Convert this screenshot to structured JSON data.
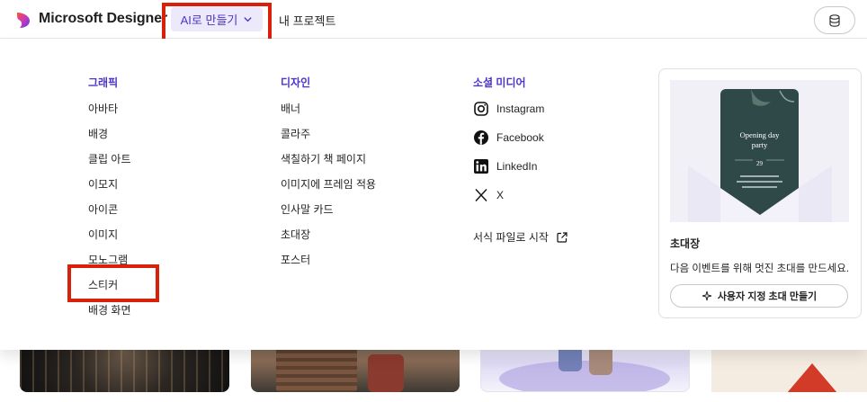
{
  "header": {
    "app_name": "Microsoft Designer",
    "ai_menu_label": "AI로 만들기",
    "projects_label": "내 프로젝트",
    "credits_icon": "coins-icon"
  },
  "menu": {
    "graphics": {
      "heading": "그래픽",
      "items": [
        "아바타",
        "배경",
        "클립 아트",
        "이모지",
        "아이콘",
        "이미지",
        "모노그램",
        "스티커",
        "배경 화면"
      ]
    },
    "design": {
      "heading": "디자인",
      "items": [
        "배너",
        "콜라주",
        "색칠하기 책 페이지",
        "이미지에 프레임 적용",
        "인사말 카드",
        "초대장",
        "포스터"
      ]
    },
    "social": {
      "heading": "소셜 미디어",
      "items": [
        {
          "label": "Instagram",
          "icon": "instagram-icon"
        },
        {
          "label": "Facebook",
          "icon": "facebook-icon"
        },
        {
          "label": "LinkedIn",
          "icon": "linkedin-icon"
        },
        {
          "label": "X",
          "icon": "x-icon"
        }
      ],
      "start_from_template": "서식 파일로 시작"
    }
  },
  "promo_card": {
    "image_text_line1": "Opening day",
    "image_text_line2": "party",
    "image_date_day": "29",
    "title": "초대장",
    "description": "다음 이벤트를 위해 멋진 초대를 만드세요.",
    "button_label": "사용자 지정 초대 만들기"
  },
  "colors": {
    "accent": "#4b36c9",
    "highlight_box": "#d9200b"
  }
}
